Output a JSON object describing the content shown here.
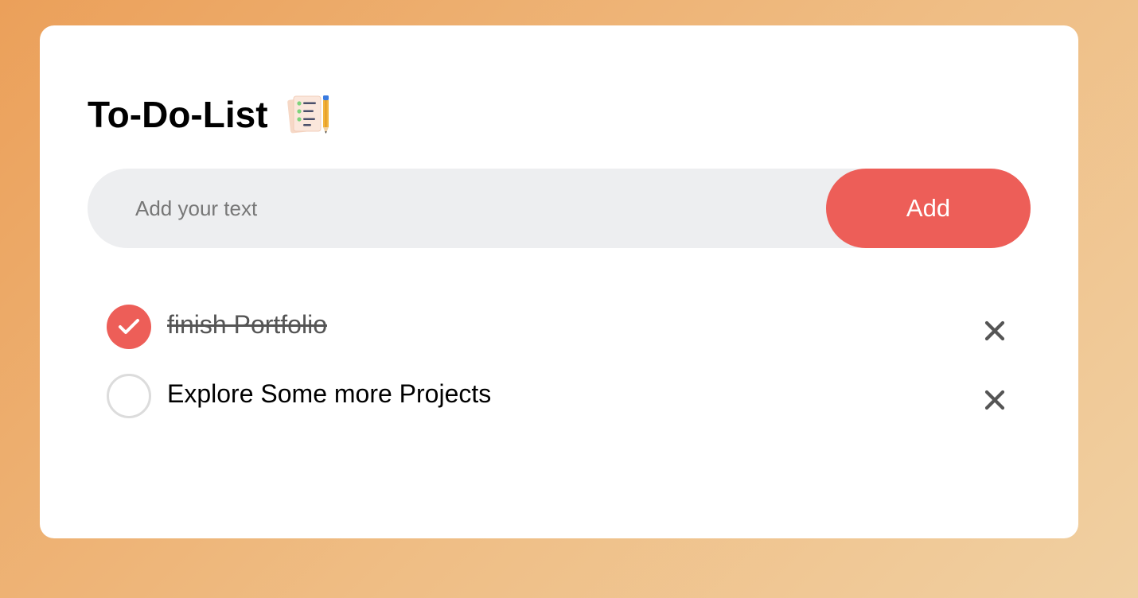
{
  "app": {
    "title": "To-Do-List",
    "title_icon": "checklist-pencil-icon"
  },
  "input": {
    "placeholder": "Add your text",
    "value": ""
  },
  "add_button": {
    "label": "Add"
  },
  "tasks": [
    {
      "text": "finish Portfolio",
      "checked": true
    },
    {
      "text": "Explore Some more Projects",
      "checked": false
    }
  ],
  "icons": {
    "check": "check-icon",
    "delete": "close-icon"
  },
  "colors": {
    "accent": "#ed5e58",
    "input_bg": "#edeef0",
    "card_bg": "#ffffff",
    "unchecked_border": "#dcdcdc",
    "delete_icon": "#555555",
    "background_start": "#eba05a",
    "background_end": "#f0d0a2"
  }
}
